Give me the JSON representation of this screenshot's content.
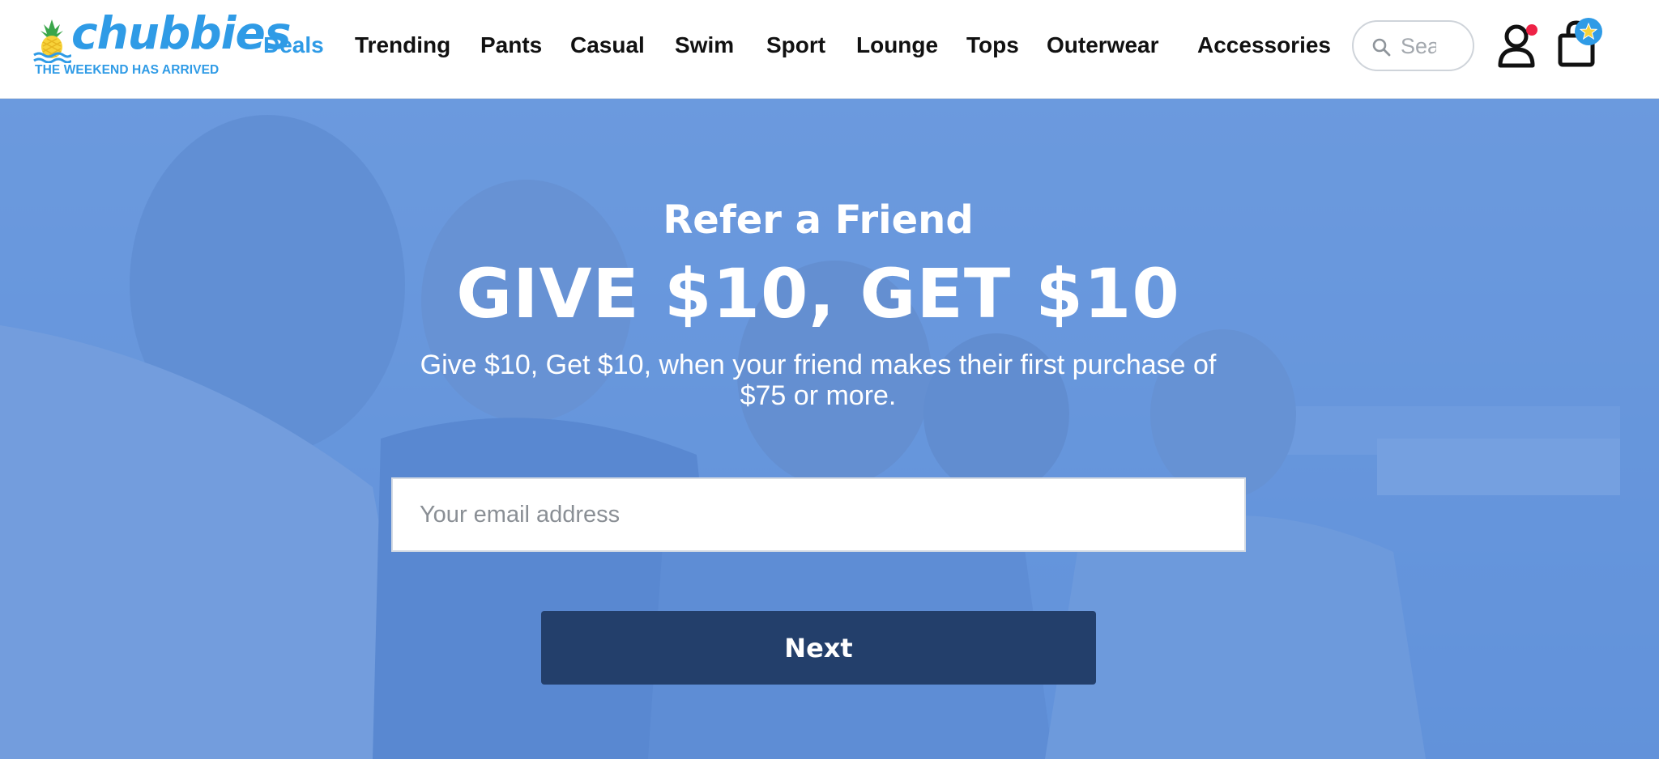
{
  "brand": {
    "name": "chubbies",
    "tagline": "THE WEEKEND HAS ARRIVED",
    "color": "#2f9be6"
  },
  "nav": {
    "items": [
      {
        "label": "Deals",
        "active": true
      },
      {
        "label": "Trending",
        "active": false
      },
      {
        "label": "Pants",
        "active": false
      },
      {
        "label": "Casual",
        "active": false
      },
      {
        "label": "Swim",
        "active": false
      },
      {
        "label": "Sport",
        "active": false
      },
      {
        "label": "Lounge",
        "active": false
      },
      {
        "label": "Tops",
        "active": false
      },
      {
        "label": "Outerwear",
        "active": false
      },
      {
        "label": "Accessories",
        "active": false
      }
    ]
  },
  "search": {
    "placeholder": "Search",
    "icon": "search-icon"
  },
  "account": {
    "icon": "user-icon",
    "notification_color": "#ee2246"
  },
  "cart": {
    "icon": "shopping-bag-icon",
    "badge_icon": "star-icon"
  },
  "hero": {
    "eyebrow": "Refer a Friend",
    "headline": "GIVE $10, GET $10",
    "subcopy": "Give $10, Get $10, when your friend makes their first purchase of $75 or more.",
    "email_placeholder": "Your email address",
    "button_label": "Next",
    "overlay_color": "#588cda",
    "button_color": "#233f6b"
  }
}
